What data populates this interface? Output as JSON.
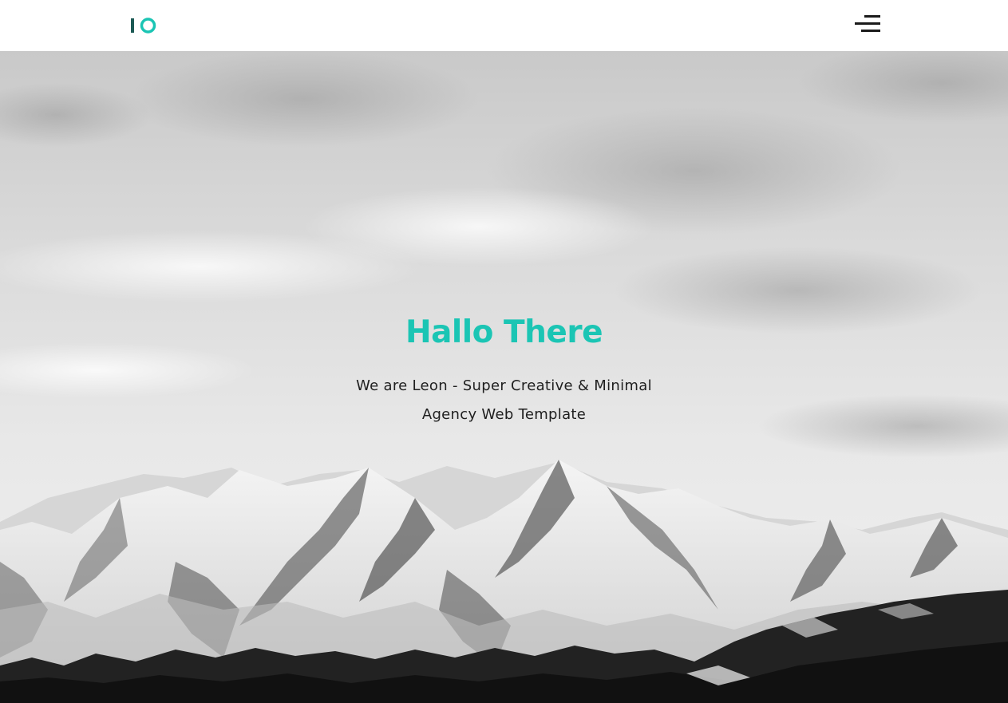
{
  "colors": {
    "accent": "#1bc5b4",
    "logo_dark": "#1c5a55",
    "text_dark": "#1f1f1f",
    "header_bg": "#ffffff"
  },
  "header": {
    "logo_icon": "io-logo",
    "menu_icon": "hamburger-menu-icon"
  },
  "hero": {
    "background": "grayscale snowy mountain range under cloudy sky",
    "title": "Hallo There",
    "subtitle": "We are Leon - Super Creative & Minimal Agency Web Template"
  }
}
